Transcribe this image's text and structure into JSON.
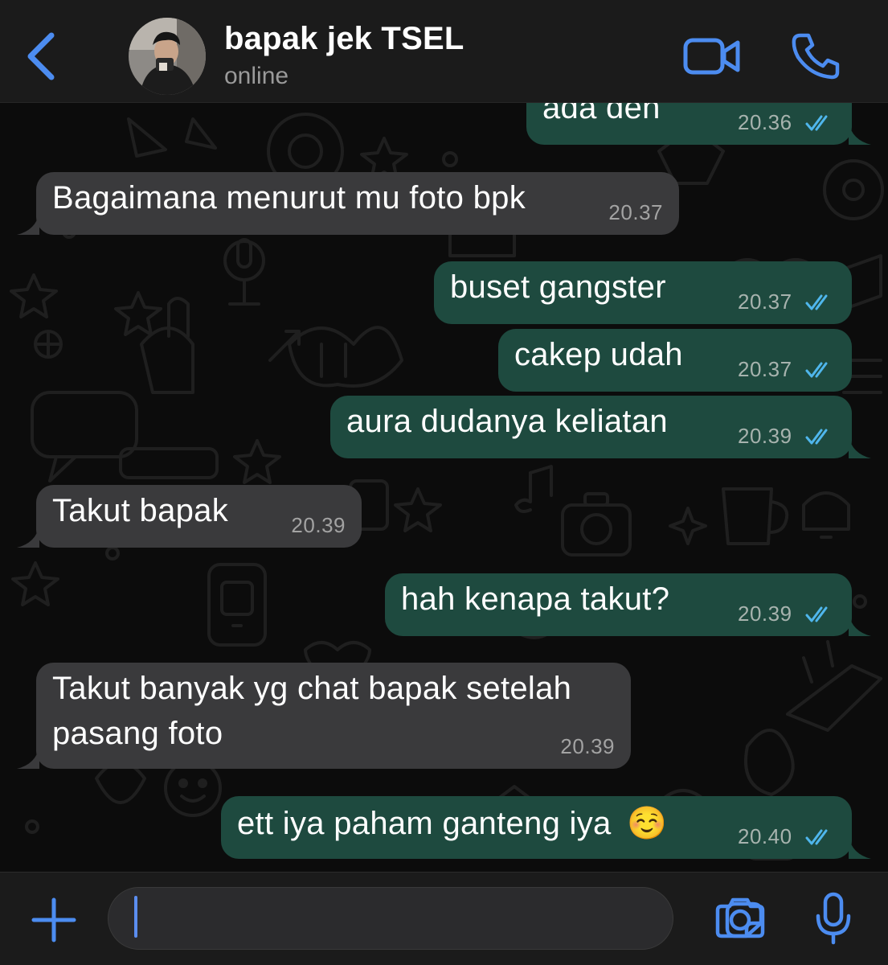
{
  "header": {
    "contact_name": "bapak jek TSEL",
    "status": "online"
  },
  "colors": {
    "accent": "#4c8cf0",
    "outgoing_bubble": "#1e4a3f",
    "incoming_bubble": "#3a3a3c",
    "read_tick": "#4fb6ec"
  },
  "messages": [
    {
      "direction": "out",
      "text": "ada deh",
      "time": "20.36",
      "status": "read"
    },
    {
      "direction": "in",
      "text": "Bagaimana menurut mu foto bpk",
      "time": "20.37"
    },
    {
      "direction": "out",
      "text": "buset gangster",
      "time": "20.37",
      "status": "read"
    },
    {
      "direction": "out",
      "text": "cakep udah",
      "time": "20.37",
      "status": "read"
    },
    {
      "direction": "out",
      "text": "aura dudanya keliatan",
      "time": "20.39",
      "status": "read"
    },
    {
      "direction": "in",
      "text": "Takut bapak",
      "time": "20.39"
    },
    {
      "direction": "out",
      "text": "hah kenapa takut?",
      "time": "20.39",
      "status": "read"
    },
    {
      "direction": "in",
      "text_lines": [
        "Takut banyak yg chat bapak setelah",
        "pasang foto"
      ],
      "time": "20.39"
    },
    {
      "direction": "out",
      "text": "ett iya paham ganteng iya",
      "emoji": "☺️",
      "time": "20.40",
      "status": "read"
    }
  ],
  "input": {
    "value": ""
  },
  "icons": {
    "back": "chevron-left-icon",
    "video": "video-camera-icon",
    "call": "phone-icon",
    "attach": "plus-icon",
    "sticker": "sticker-icon",
    "camera": "camera-icon",
    "mic": "microphone-icon"
  }
}
